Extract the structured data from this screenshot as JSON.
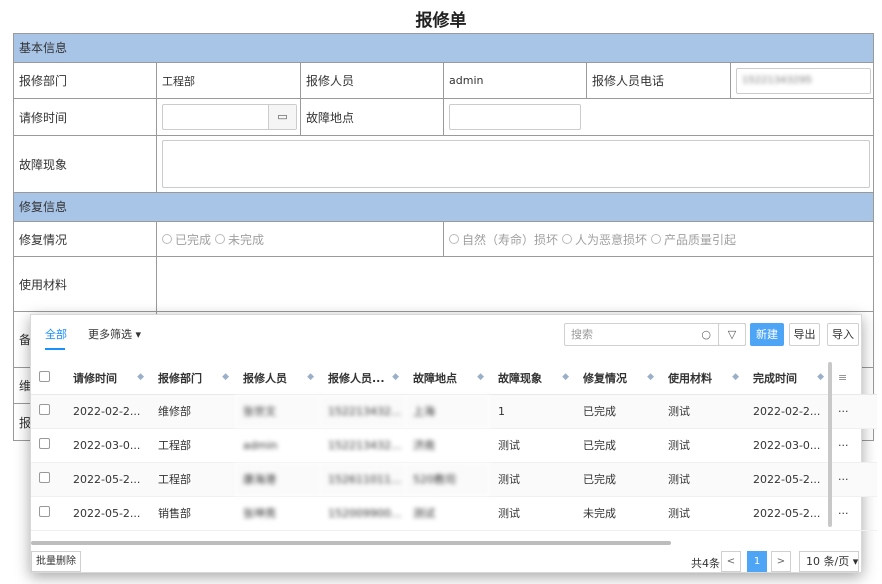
{
  "title": "报修单",
  "form": {
    "section_basic": "基本信息",
    "dept_label": "报修部门",
    "dept_value": "工程部",
    "person_label": "报修人员",
    "person_value": "admin",
    "phone_label": "报修人员电话",
    "phone_value": "15221343295",
    "time_label": "请修时间",
    "calendar_icon": "calendar-icon",
    "place_label": "故障地点",
    "symptom_label": "故障现象",
    "section_repair": "修复信息",
    "status_label": "修复情况",
    "status_options": [
      "已完成",
      "未完成"
    ],
    "cause_options": [
      "自然（寿命）损坏",
      "人为恶意损坏",
      "产品质量引起"
    ],
    "material_label": "使用材料",
    "hidden_label_1": "备",
    "hidden_label_2": "维",
    "hidden_label_3": "报"
  },
  "panel": {
    "tab_all": "全部",
    "tab_more": "更多筛选",
    "search_placeholder": "搜索",
    "search_icon": "search-icon",
    "filter_icon": "filter-icon",
    "btn_new": "新建",
    "btn_export": "导出",
    "btn_import": "导入",
    "columns": [
      "请修时间",
      "报修部门",
      "报修人员",
      "报修人员...",
      "故障地点",
      "故障现象",
      "修复情况",
      "使用材料",
      "完成时间"
    ],
    "rows": [
      {
        "time": "2022-02-2...",
        "dept": "维修部",
        "person": "张世文",
        "phone": "152213432...",
        "place": "上海",
        "symptom": "1",
        "status": "已完成",
        "material": "测试",
        "done": "2022-02-2..."
      },
      {
        "time": "2022-03-0...",
        "dept": "工程部",
        "person": "admin",
        "phone": "152213432...",
        "place": "济南",
        "symptom": "测试",
        "status": "已完成",
        "material": "测试",
        "done": "2022-03-0..."
      },
      {
        "time": "2022-05-2...",
        "dept": "工程部",
        "person": "康海港",
        "phone": "152611011...",
        "place": "520教司",
        "symptom": "测试",
        "status": "已完成",
        "material": "测试",
        "done": "2022-05-2..."
      },
      {
        "time": "2022-05-2...",
        "dept": "销售部",
        "person": "张坤亮",
        "phone": "152009900...",
        "place": "测试",
        "symptom": "测试",
        "status": "未完成",
        "material": "测试",
        "done": "2022-05-2..."
      }
    ],
    "row_more": "···",
    "bulk_delete": "批量删除",
    "total": "共4条",
    "prev": "<",
    "page": "1",
    "next": ">",
    "page_size": "10 条/页"
  }
}
